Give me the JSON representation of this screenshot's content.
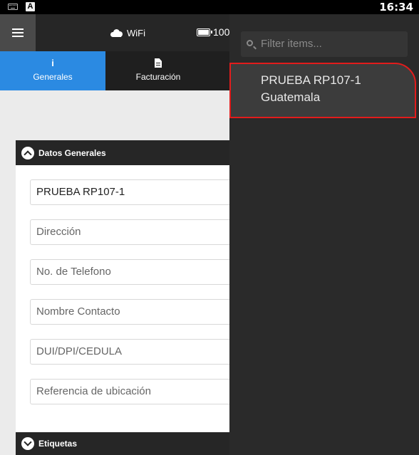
{
  "status_bar": {
    "time": "16:34",
    "a_badge": "A",
    "icons": [
      "keyboard-icon",
      "a-badge-icon"
    ]
  },
  "header": {
    "wifi_label": "WiFi",
    "battery_label": "100",
    "menu_icon": "hamburger-menu-icon"
  },
  "tabs": [
    {
      "label": "Generales",
      "icon": "info-icon",
      "active": true
    },
    {
      "label": "Facturación",
      "icon": "document-icon",
      "active": false
    }
  ],
  "section_general": {
    "title": "Datos Generales",
    "fields": [
      {
        "value": "PRUEBA RP107-1",
        "placeholder": ""
      },
      {
        "value": "",
        "placeholder": "Dirección"
      },
      {
        "value": "",
        "placeholder": "No. de Telefono"
      },
      {
        "value": "",
        "placeholder": "Nombre Contacto"
      },
      {
        "value": "",
        "placeholder": "DUI/DPI/CEDULA"
      },
      {
        "value": "",
        "placeholder": "Referencia de ubicación"
      }
    ]
  },
  "section_tags": {
    "title": "Etiquetas"
  },
  "drawer": {
    "filter_placeholder": "Filter items...",
    "items": [
      {
        "line1": "PRUEBA RP107-1",
        "line2": "Guatemala"
      }
    ]
  },
  "colors": {
    "accent": "#2b8ae2",
    "highlight_border": "#e21c1c"
  }
}
